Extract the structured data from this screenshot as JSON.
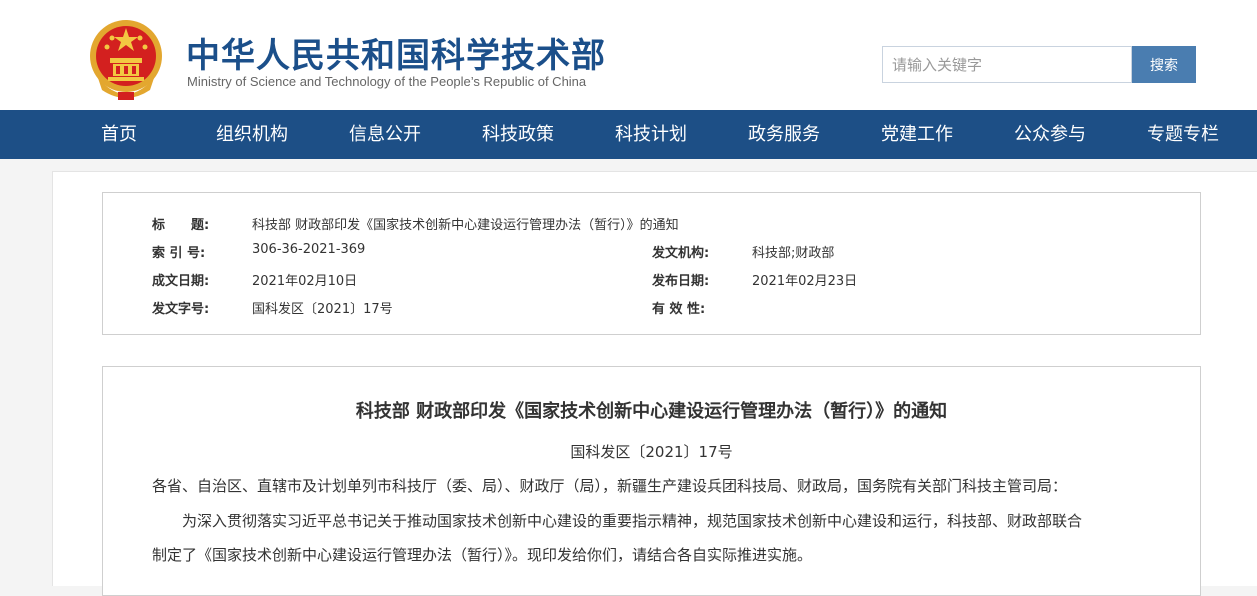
{
  "header": {
    "site_title": "中华人民共和国科学技术部",
    "site_subtitle": "Ministry of Science and Technology of the People’s Republic of China",
    "search": {
      "placeholder": "请输入关键字",
      "button_label": "搜索"
    }
  },
  "nav": {
    "items": [
      {
        "label": "首页"
      },
      {
        "label": "组织机构"
      },
      {
        "label": "信息公开"
      },
      {
        "label": "科技政策"
      },
      {
        "label": "科技计划"
      },
      {
        "label": "政务服务"
      },
      {
        "label": "党建工作"
      },
      {
        "label": "公众参与"
      },
      {
        "label": "专题专栏"
      }
    ]
  },
  "meta": {
    "title_label": "标　　题:",
    "title_value": "科技部 财政部印发《国家技术创新中心建设运行管理办法（暂行）》的通知",
    "index_label": "索 引 号:",
    "index_value": "306-36-2021-369",
    "issuer_label": "发文机构:",
    "issuer_value": "科技部;财政部",
    "written_label": "成文日期:",
    "written_value": "2021年02月10日",
    "published_label": "发布日期:",
    "published_value": "2021年02月23日",
    "docnum_label": "发文字号:",
    "docnum_value": "国科发区〔2021〕17号",
    "validity_label": "有 效 性:"
  },
  "article": {
    "title": "科技部 财政部印发《国家技术创新中心建设运行管理办法（暂行）》的通知",
    "doc_number": "国科发区〔2021〕17号",
    "salutation": "各省、自治区、直辖市及计划单列市科技厅（委、局）、财政厅（局），新疆生产建设兵团科技局、财政局，国务院有关部门科技主管司局：",
    "body_line1": "为深入贯彻落实习近平总书记关于推动国家技术创新中心建设的重要指示精神，规范国家技术创新中心建设和运行，科技部、财政部联合",
    "body_line2": "制定了《国家技术创新中心建设运行管理办法（暂行）》。现印发给你们，请结合各自实际推进实施。"
  }
}
